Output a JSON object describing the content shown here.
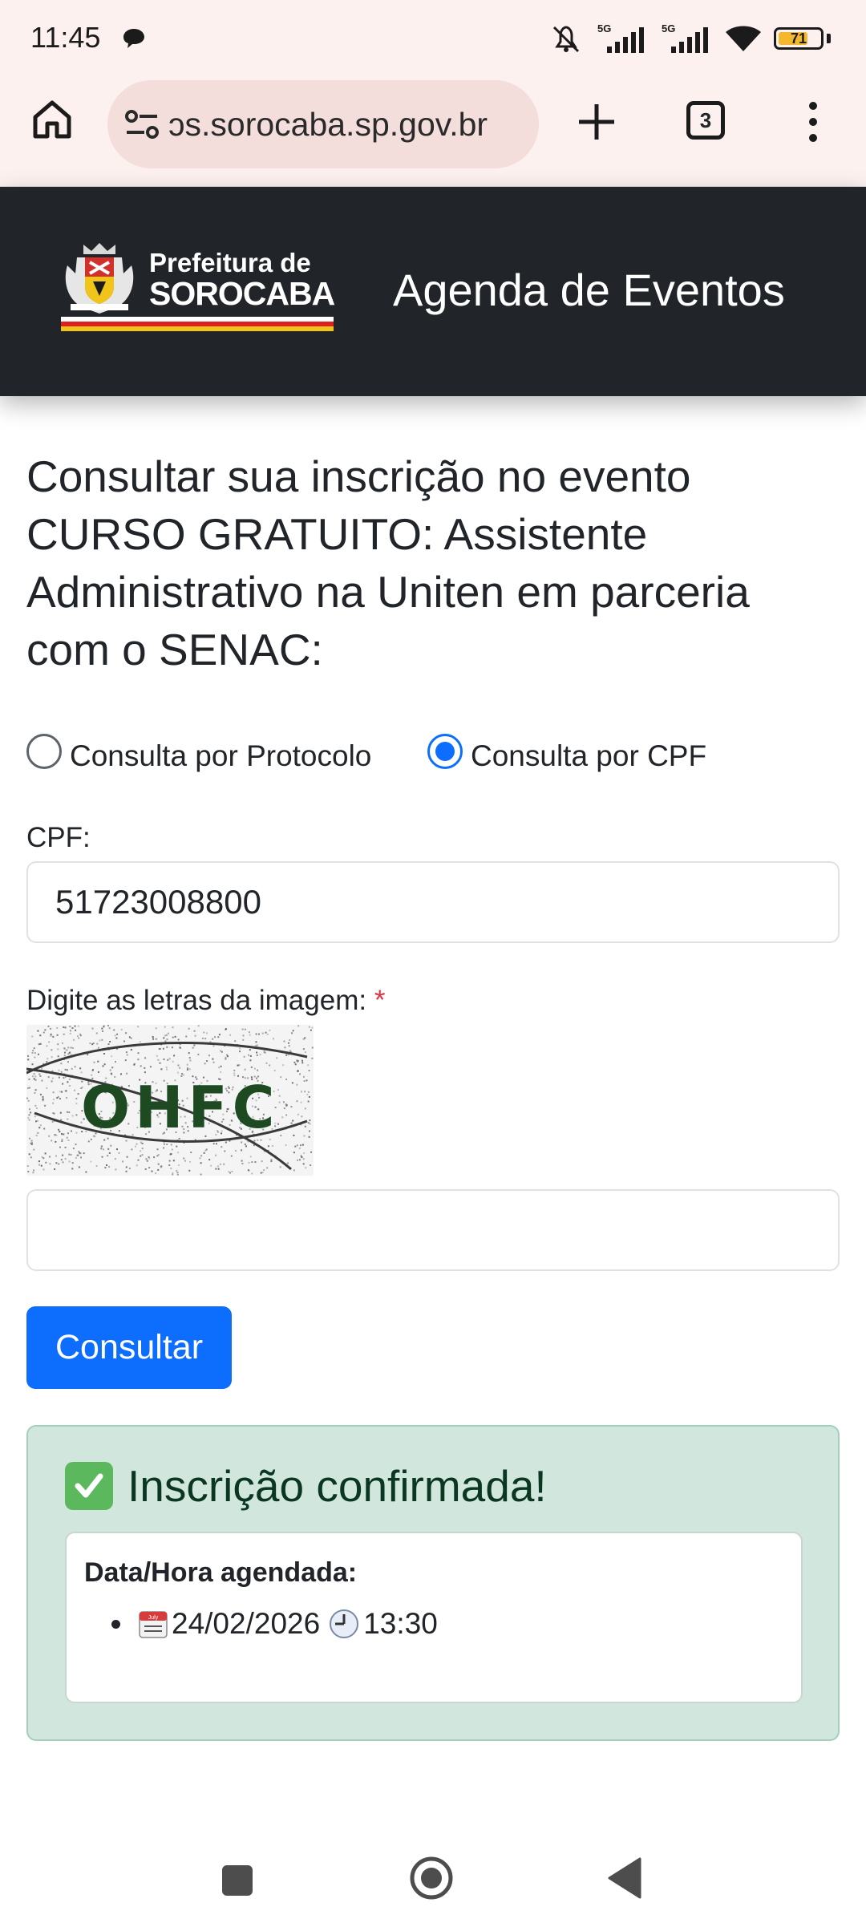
{
  "status_bar": {
    "time": "11:45",
    "battery_level": "71",
    "network_1": "5G",
    "network_2": "5G"
  },
  "browser": {
    "url": "ɔs.sorocaba.sp.gov.br",
    "tab_count": "3"
  },
  "header": {
    "logo_line1": "Prefeitura de",
    "logo_line2": "SOROCABA",
    "title": "Agenda de Eventos"
  },
  "page": {
    "heading": "Consultar sua inscrição no evento CURSO GRATUITO: Assistente Administrativo na Uniten em parceria com o SENAC:"
  },
  "lookup": {
    "options": [
      {
        "label": "Consulta por Protocolo",
        "selected": false
      },
      {
        "label": "Consulta por CPF",
        "selected": true
      }
    ],
    "cpf_label": "CPF:",
    "cpf_value": "51723008800",
    "captcha_label": "Digite as letras da imagem:",
    "required_marker": "*",
    "captcha_text": "OHFC",
    "captcha_value": "",
    "submit_label": "Consultar"
  },
  "result": {
    "title": "Inscrição confirmada!",
    "card_label": "Data/Hora agendada:",
    "date": "24/02/2026",
    "time": "13:30",
    "calendar_month": "July"
  },
  "colors": {
    "accent": "#0d6efd",
    "header_bg": "#212529",
    "success_bg": "#d1e7dd",
    "success_text": "#0a3622",
    "browser_bg": "#fdf1ef"
  },
  "icons": {
    "home": "home-icon",
    "site_settings": "tune-icon",
    "new_tab": "plus-icon",
    "menu": "more-vert-icon",
    "check": "check-mark-icon",
    "calendar": "calendar-icon",
    "clock": "clock-icon"
  }
}
